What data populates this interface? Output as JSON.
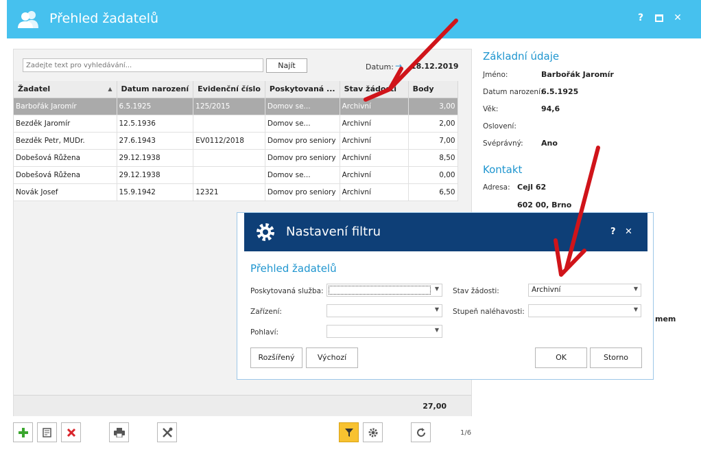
{
  "window": {
    "title": "Přehled žadatelů",
    "help_label": "?",
    "close_label": "✕"
  },
  "search": {
    "placeholder": "Zadejte text pro vyhledávání...",
    "find_label": "Najít",
    "date_label": "Datum:",
    "date_value": "18.12.2019"
  },
  "table": {
    "columns": [
      "Žadatel",
      "Datum narození",
      "Evidenční číslo",
      "Poskytovaná ...",
      "Stav žádosti",
      "Body"
    ],
    "rows": [
      {
        "name": "Barbořák Jaromír",
        "birth": "6.5.1925",
        "evid": "125/2015",
        "service": "Domov se...",
        "status": "Archivní",
        "points": "3,00"
      },
      {
        "name": "Bezděk Jaromír",
        "birth": "12.5.1936",
        "evid": "",
        "service": "Domov se...",
        "status": "Archivní",
        "points": "2,00"
      },
      {
        "name": "Bezděk Petr, MUDr.",
        "birth": "27.6.1943",
        "evid": "EV0112/2018",
        "service": "Domov pro seniory",
        "status": "Archivní",
        "points": "7,00"
      },
      {
        "name": "Dobešová Růžena",
        "birth": "29.12.1938",
        "evid": "",
        "service": "Domov pro seniory",
        "status": "Archivní",
        "points": "8,50"
      },
      {
        "name": "Dobešová Růžena",
        "birth": "29.12.1938",
        "evid": "",
        "service": "Domov se...",
        "status": "Archivní",
        "points": "0,00"
      },
      {
        "name": "Novák Josef",
        "birth": "15.9.1942",
        "evid": "12321",
        "service": "Domov pro seniory",
        "status": "Archivní",
        "points": "6,50"
      }
    ],
    "total": "27,00"
  },
  "pager": "1/6",
  "detail": {
    "basic_title": "Základní údaje",
    "name_label": "Jméno:",
    "name_value": "Barbořák Jaromír",
    "birth_label": "Datum narození:",
    "birth_value": "6.5.1925",
    "age_label": "Věk:",
    "age_value": "94,6",
    "salutation_label": "Oslovení:",
    "competent_label": "Svéprávný:",
    "competent_value": "Ano",
    "contact_title": "Kontakt",
    "address_label": "Adresa:",
    "address_line1": "Cejl 62",
    "address_line2": "602 00, Brno",
    "partial_text": "mem"
  },
  "dialog": {
    "title": "Nastavení filtru",
    "help_label": "?",
    "close_label": "✕",
    "subtitle": "Přehled žadatelů",
    "service_label": "Poskytovaná služba:",
    "facility_label": "Zařízení:",
    "gender_label": "Pohlaví:",
    "status_label": "Stav žádosti:",
    "status_value": "Archivní",
    "urgency_label": "Stupeň naléhavosti:",
    "extended_label": "Rozšířený",
    "default_label": "Výchozí",
    "ok_label": "OK",
    "cancel_label": "Storno"
  },
  "icons": {
    "app": "users-icon",
    "add": "plus-icon",
    "edit": "edit-icon",
    "delete": "delete-icon",
    "print": "print-icon",
    "tools": "tools-icon",
    "filter": "filter-icon",
    "settings": "gear-icon",
    "refresh": "refresh-icon"
  },
  "colors": {
    "titlebar": "#46c1ee",
    "dialog_header": "#0e3f77",
    "accent_text": "#1e95cf",
    "annotation_arrow": "#d0141a",
    "filter_active": "#f8c230"
  }
}
